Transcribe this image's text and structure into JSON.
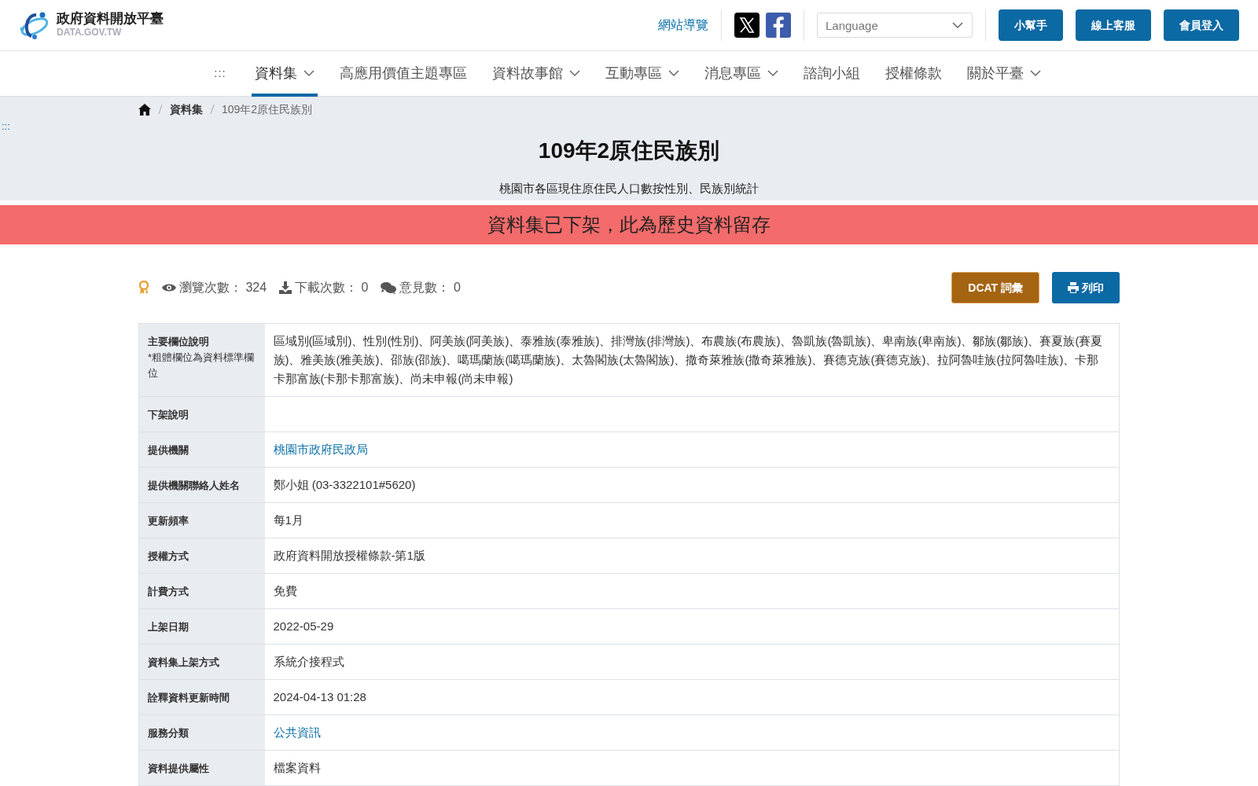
{
  "header": {
    "logo_title": "政府資料開放平臺",
    "logo_subtitle": "DATA.GOV.TW",
    "sitemap_link": "網站導覽",
    "language": {
      "placeholder": "Language"
    },
    "buttons": [
      "小幫手",
      "線上客服",
      "會員登入"
    ]
  },
  "nav": {
    "accesskey": ":::",
    "items": [
      {
        "label": "資料集",
        "dropdown": true,
        "selected": true
      },
      {
        "label": "高應用價值主題專區",
        "dropdown": false,
        "selected": false
      },
      {
        "label": "資料故事館",
        "dropdown": true,
        "selected": false
      },
      {
        "label": "互動專區",
        "dropdown": true,
        "selected": false
      },
      {
        "label": "消息專區",
        "dropdown": true,
        "selected": false
      },
      {
        "label": "諮詢小組",
        "dropdown": false,
        "selected": false
      },
      {
        "label": "授權條款",
        "dropdown": false,
        "selected": false
      },
      {
        "label": "關於平臺",
        "dropdown": true,
        "selected": false
      }
    ]
  },
  "breadcrumb": {
    "items": [
      "資料集",
      "109年2原住民族別"
    ]
  },
  "accesskey": ":::",
  "title": "109年2原住民族別",
  "subtitle": "桃園市各區現住原住民人口數按性別、民族別統計",
  "banner": "資料集已下架，此為歷史資料留存",
  "stats": [
    {
      "kind": "views",
      "text": "瀏覽次數： 324"
    },
    {
      "kind": "downloads",
      "text": "下載次數： 0"
    },
    {
      "kind": "comments",
      "text": "意見數： 0"
    }
  ],
  "actions": [
    {
      "kind": "dcat",
      "label": "DCAT 詞彙"
    },
    {
      "kind": "print",
      "label": "列印"
    }
  ],
  "table": {
    "rows": [
      {
        "label": "主要欄位說明",
        "note": "*粗體欄位為資料標準欄位",
        "kind": "text",
        "value": "區域別(區域別)、性別(性別)、阿美族(阿美族)、泰雅族(泰雅族)、排灣族(排灣族)、布農族(布農族)、魯凱族(魯凱族)、卑南族(卑南族)、鄒族(鄒族)、賽夏族(賽夏族)、雅美族(雅美族)、邵族(邵族)、噶瑪蘭族(噶瑪蘭族)、太魯閣族(太魯閣族)、撒奇萊雅族(撒奇萊雅族)、賽德克族(賽德克族)、拉阿魯哇族(拉阿魯哇族)、卡那卡那富族(卡那卡那富族)、尚未申報(尚未申報)"
      },
      {
        "label": "下架說明",
        "kind": "empty"
      },
      {
        "label": "提供機關",
        "kind": "link",
        "value": "桃園市政府民政局"
      },
      {
        "label": "提供機關聯絡人姓名",
        "kind": "text",
        "value": "鄭小姐 (03-3322101#5620)"
      },
      {
        "label": "更新頻率",
        "kind": "text",
        "value": "每1月"
      },
      {
        "label": "授權方式",
        "kind": "text",
        "value": "政府資料開放授權條款-第1版"
      },
      {
        "label": "計費方式",
        "kind": "text",
        "value": "免費"
      },
      {
        "label": "上架日期",
        "kind": "text",
        "value": "2022-05-29"
      },
      {
        "label": "資料集上架方式",
        "kind": "text",
        "value": "系統介接程式"
      },
      {
        "label": "詮釋資料更新時間",
        "kind": "text",
        "value": "2024-04-13 01:28"
      },
      {
        "label": "服務分類",
        "kind": "link",
        "value": "公共資訊"
      },
      {
        "label": "資料提供屬性",
        "kind": "text",
        "value": "檔案資料"
      }
    ]
  }
}
